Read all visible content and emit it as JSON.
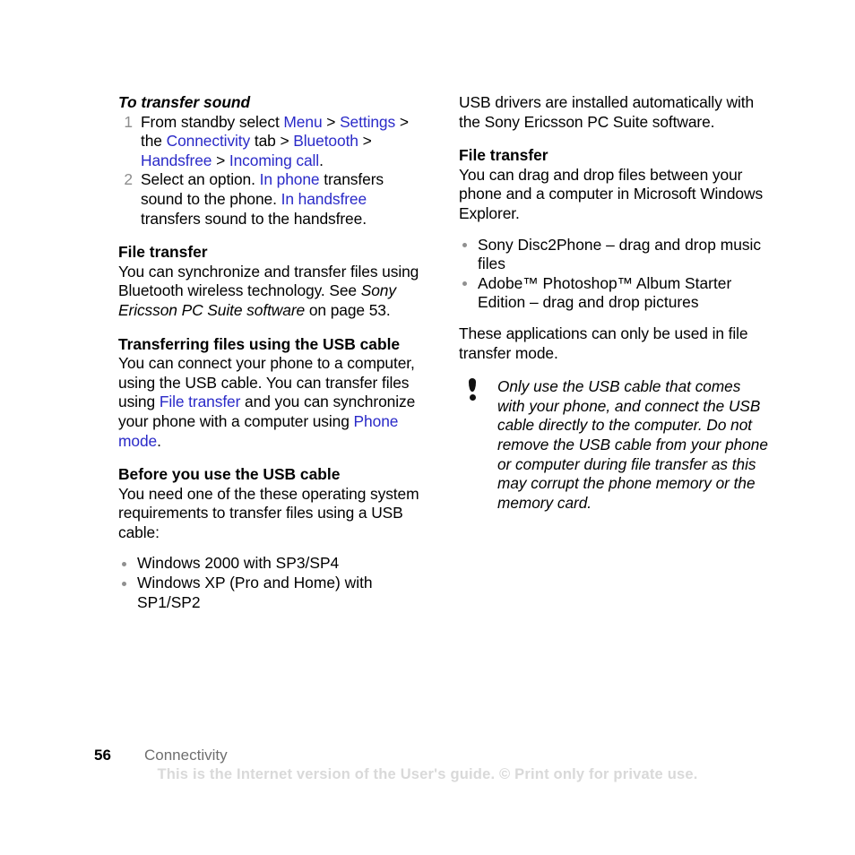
{
  "page": {
    "number": "56",
    "section": "Connectivity",
    "watermark": "This is the Internet version of the User's guide. © Print only for private use."
  },
  "left_column": {
    "procedure": {
      "title": "To transfer sound",
      "steps": [
        {
          "number": "1",
          "parts": [
            {
              "text": "From standby select ",
              "style": "plain"
            },
            {
              "text": "Menu",
              "style": "link"
            },
            {
              "text": " > ",
              "style": "plain"
            },
            {
              "text": "Settings",
              "style": "link"
            },
            {
              "text": " > the ",
              "style": "plain"
            },
            {
              "text": "Connectivity",
              "style": "link"
            },
            {
              "text": " tab > ",
              "style": "plain"
            },
            {
              "text": "Bluetooth",
              "style": "link"
            },
            {
              "text": " > ",
              "style": "plain"
            },
            {
              "text": "Handsfree",
              "style": "link"
            },
            {
              "text": " > ",
              "style": "plain"
            },
            {
              "text": "Incoming call",
              "style": "link"
            },
            {
              "text": ".",
              "style": "plain"
            }
          ]
        },
        {
          "number": "2",
          "parts": [
            {
              "text": "Select an option. ",
              "style": "plain"
            },
            {
              "text": "In phone",
              "style": "link"
            },
            {
              "text": " transfers sound to the phone. ",
              "style": "plain"
            },
            {
              "text": "In handsfree",
              "style": "link"
            },
            {
              "text": " transfers sound to the handsfree.",
              "style": "plain"
            }
          ]
        }
      ]
    },
    "file_transfer": {
      "heading": "File transfer",
      "parts": [
        {
          "text": "You can synchronize and transfer files using Bluetooth wireless technology. See ",
          "style": "plain"
        },
        {
          "text": "Sony Ericsson PC Suite software",
          "style": "italic"
        },
        {
          "text": " on page 53.",
          "style": "plain"
        }
      ]
    },
    "usb_cable": {
      "heading": "Transferring files using the USB cable",
      "parts": [
        {
          "text": "You can connect your phone to a computer, using the USB cable. You can transfer files using ",
          "style": "plain"
        },
        {
          "text": "File transfer",
          "style": "link"
        },
        {
          "text": " and you can synchronize your phone with a computer using ",
          "style": "plain"
        },
        {
          "text": "Phone mode",
          "style": "link"
        },
        {
          "text": ".",
          "style": "plain"
        }
      ]
    },
    "before_use": {
      "heading": "Before you use the USB cable",
      "body": "You need one of the these operating system requirements to transfer files using a USB cable:",
      "bullets": [
        "Windows 2000 with SP3/SP4",
        "Windows XP (Pro and Home) with SP1/SP2"
      ]
    }
  },
  "right_column": {
    "drivers_note": "USB drivers are installed automatically with the Sony Ericsson PC Suite software.",
    "file_transfer": {
      "heading": "File transfer",
      "body": "You can drag and drop files between your phone and a computer in Microsoft Windows Explorer.",
      "bullets": [
        "Sony Disc2Phone – drag and drop music files",
        "Adobe™ Photoshop™ Album Starter Edition – drag and drop pictures"
      ],
      "closing": "These applications can only be used in file transfer mode."
    },
    "warning": {
      "icon": "exclamation-icon",
      "text": "Only use the USB cable that comes with your phone, and connect the USB cable directly to the computer. Do not remove the USB cable from your phone or computer during file transfer as this may corrupt the phone memory or the memory card."
    }
  },
  "colors": {
    "link": "#2a2ac8",
    "marker_gray": "#8d8d8d",
    "footer_section": "#6f6f6f",
    "watermark": "#d9d9d9"
  }
}
